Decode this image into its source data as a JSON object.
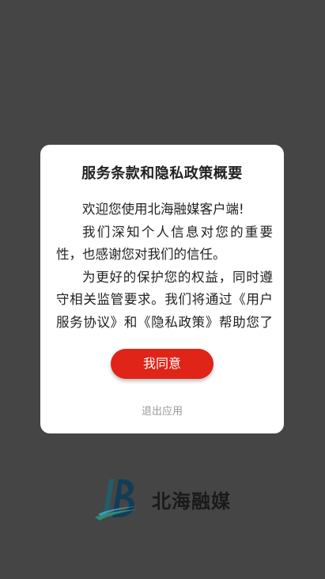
{
  "background_color": "#454545",
  "dialog": {
    "title": "服务条款和隐私政策概要",
    "paragraphs": [
      "欢迎您使用北海融媒客户端!",
      "我们深知个人信息对您的重要性，也感谢您对我们的信任。",
      "为更好的保护您的权益，同时遵守相关监管要求。我们将通过《用户服务协议》和《隐私政策》帮助您了解我们收集、使用、存储"
    ],
    "agree_label": "我同意",
    "exit_label": "退出应用",
    "accent_color": "#e02418"
  },
  "splash": {
    "app_name": "北海融媒",
    "logo_icon": "beihai-media-logo-icon"
  }
}
